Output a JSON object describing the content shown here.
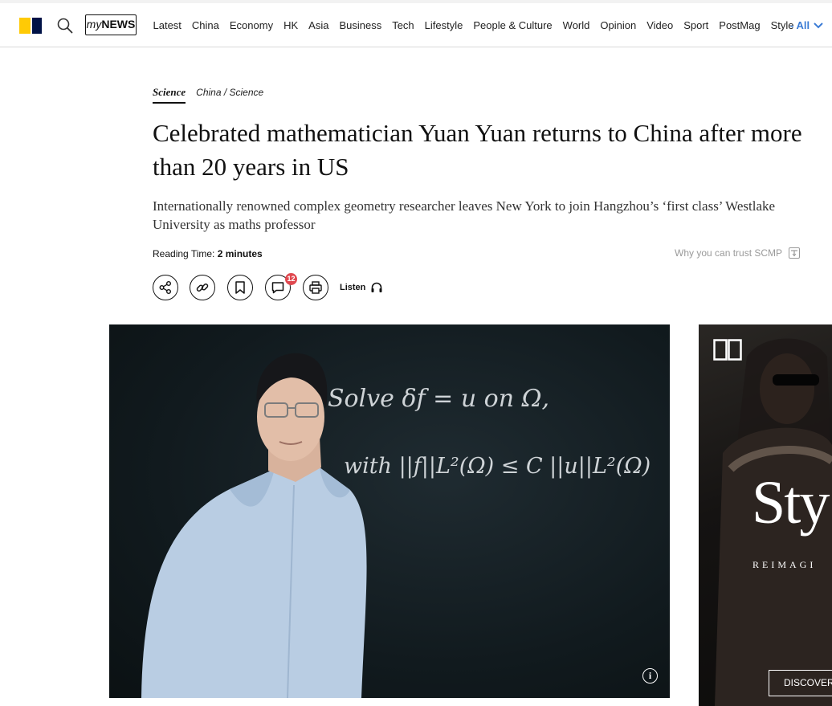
{
  "nav": {
    "mynews_prefix": "my",
    "mynews_suffix": "NEWS",
    "items": [
      "Latest",
      "China",
      "Economy",
      "HK",
      "Asia",
      "Business",
      "Tech",
      "Lifestyle",
      "People & Culture",
      "World",
      "Opinion",
      "Video",
      "Sport",
      "PostMag",
      "Style"
    ],
    "all_label": "- All",
    "logo_colors": {
      "primary": "#ffca05",
      "secondary": "#001246"
    }
  },
  "article": {
    "section": "Science",
    "breadcrumb": "China / Science",
    "headline": "Celebrated mathematician Yuan Yuan returns to China after more than 20 years in US",
    "subheadline": "Internationally renowned complex geometry researcher leaves New York to join Hangzhou’s ‘first class’ Westlake University as maths professor",
    "reading_time_label": "Reading Time:",
    "reading_time_value": "2 minutes",
    "trust_label": "Why you can trust SCMP",
    "comment_count": "12",
    "listen_label": "Listen"
  },
  "hero": {
    "board_line1": "Solve   δf = u   on Ω,",
    "board_line2": "with   ||f||L²(Ω) ≤ C ||u||L²(Ω)"
  },
  "ad": {
    "wordmark": "Sty",
    "tagline": "REIMAGI",
    "cta": "DISCOVER"
  },
  "colors": {
    "accent_blue": "#3a7bd5",
    "badge_red": "#e0484f"
  }
}
